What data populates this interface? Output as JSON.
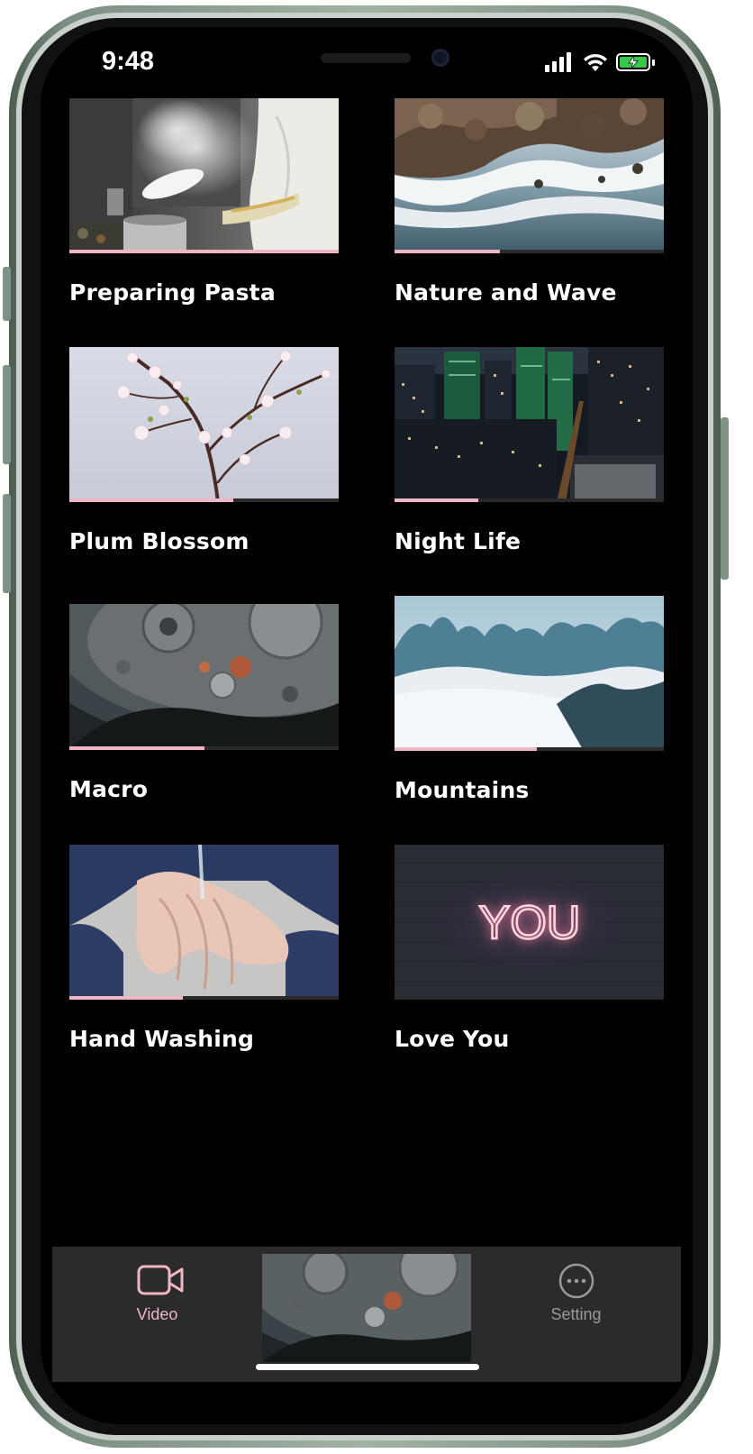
{
  "status": {
    "time": "9:48"
  },
  "videos": [
    {
      "title": "Preparing Pasta",
      "progress": 1.0,
      "image": "chef-cooking-pasta"
    },
    {
      "title": "Nature and Wave",
      "progress": 0.39,
      "image": "aerial-ocean-waves-rocks"
    },
    {
      "title": "Plum Blossom",
      "progress": 0.61,
      "image": "plum-blossom-branch"
    },
    {
      "title": "Night Life",
      "progress": 0.31,
      "image": "city-at-night"
    },
    {
      "title": "Macro",
      "progress": 0.5,
      "image": "watch-movement-macro"
    },
    {
      "title": "Mountains",
      "progress": 0.53,
      "image": "mountains-above-clouds"
    },
    {
      "title": "Hand Washing",
      "progress": 0.42,
      "image": "hands-washing"
    },
    {
      "title": "Love You",
      "progress": 0,
      "image": "neon-you-sign",
      "neon_text": "YOU"
    }
  ],
  "tabbar": {
    "video_label": "Video",
    "setting_label": "Setting",
    "active_color": "#efb7c3",
    "inactive_color": "#9a9a9a",
    "video_icon": "video-camera-icon",
    "setting_icon": "more-circle-icon",
    "now_playing": "watch-movement-macro"
  },
  "colors": {
    "accent": "#efb7c3",
    "background": "#000000"
  }
}
